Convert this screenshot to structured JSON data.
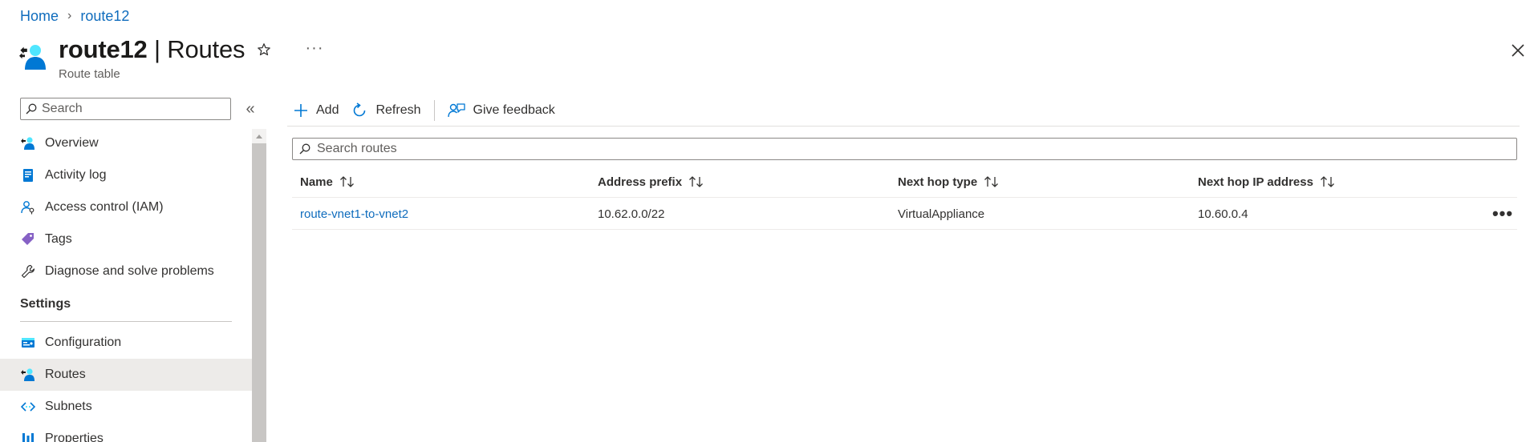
{
  "breadcrumb": {
    "home": "Home",
    "current": "route12"
  },
  "header": {
    "title_main": "route12",
    "title_sep": " | ",
    "title_section": "Routes",
    "subtitle": "Route table",
    "more": "···",
    "resource_icon": "route-table-icon"
  },
  "sidebar": {
    "search_placeholder": "Search",
    "collapse_glyph": "«",
    "items": [
      {
        "label": "Overview",
        "icon": "overview-icon"
      },
      {
        "label": "Activity log",
        "icon": "activity-log-icon"
      },
      {
        "label": "Access control (IAM)",
        "icon": "iam-icon"
      },
      {
        "label": "Tags",
        "icon": "tag-icon"
      },
      {
        "label": "Diagnose and solve problems",
        "icon": "wrench-icon"
      }
    ],
    "section_title": "Settings",
    "settings_items": [
      {
        "label": "Configuration",
        "icon": "configuration-icon"
      },
      {
        "label": "Routes",
        "icon": "routes-icon",
        "selected": true
      },
      {
        "label": "Subnets",
        "icon": "subnets-icon"
      },
      {
        "label": "Properties",
        "icon": "properties-icon"
      }
    ]
  },
  "toolbar": {
    "add_label": "Add",
    "refresh_label": "Refresh",
    "feedback_label": "Give feedback"
  },
  "routes_search": {
    "placeholder": "Search routes"
  },
  "table": {
    "columns": [
      "Name",
      "Address prefix",
      "Next hop type",
      "Next hop IP address"
    ],
    "rows": [
      {
        "name": "route-vnet1-to-vnet2",
        "address_prefix": "10.62.0.0/22",
        "next_hop_type": "VirtualAppliance",
        "next_hop_ip": "10.60.0.4"
      }
    ],
    "row_more": "•••"
  },
  "colors": {
    "accent": "#0f6cbd",
    "selected_bg": "#edebe9",
    "azure_blue": "#0078d4",
    "azure_cyan": "#50e6ff"
  }
}
